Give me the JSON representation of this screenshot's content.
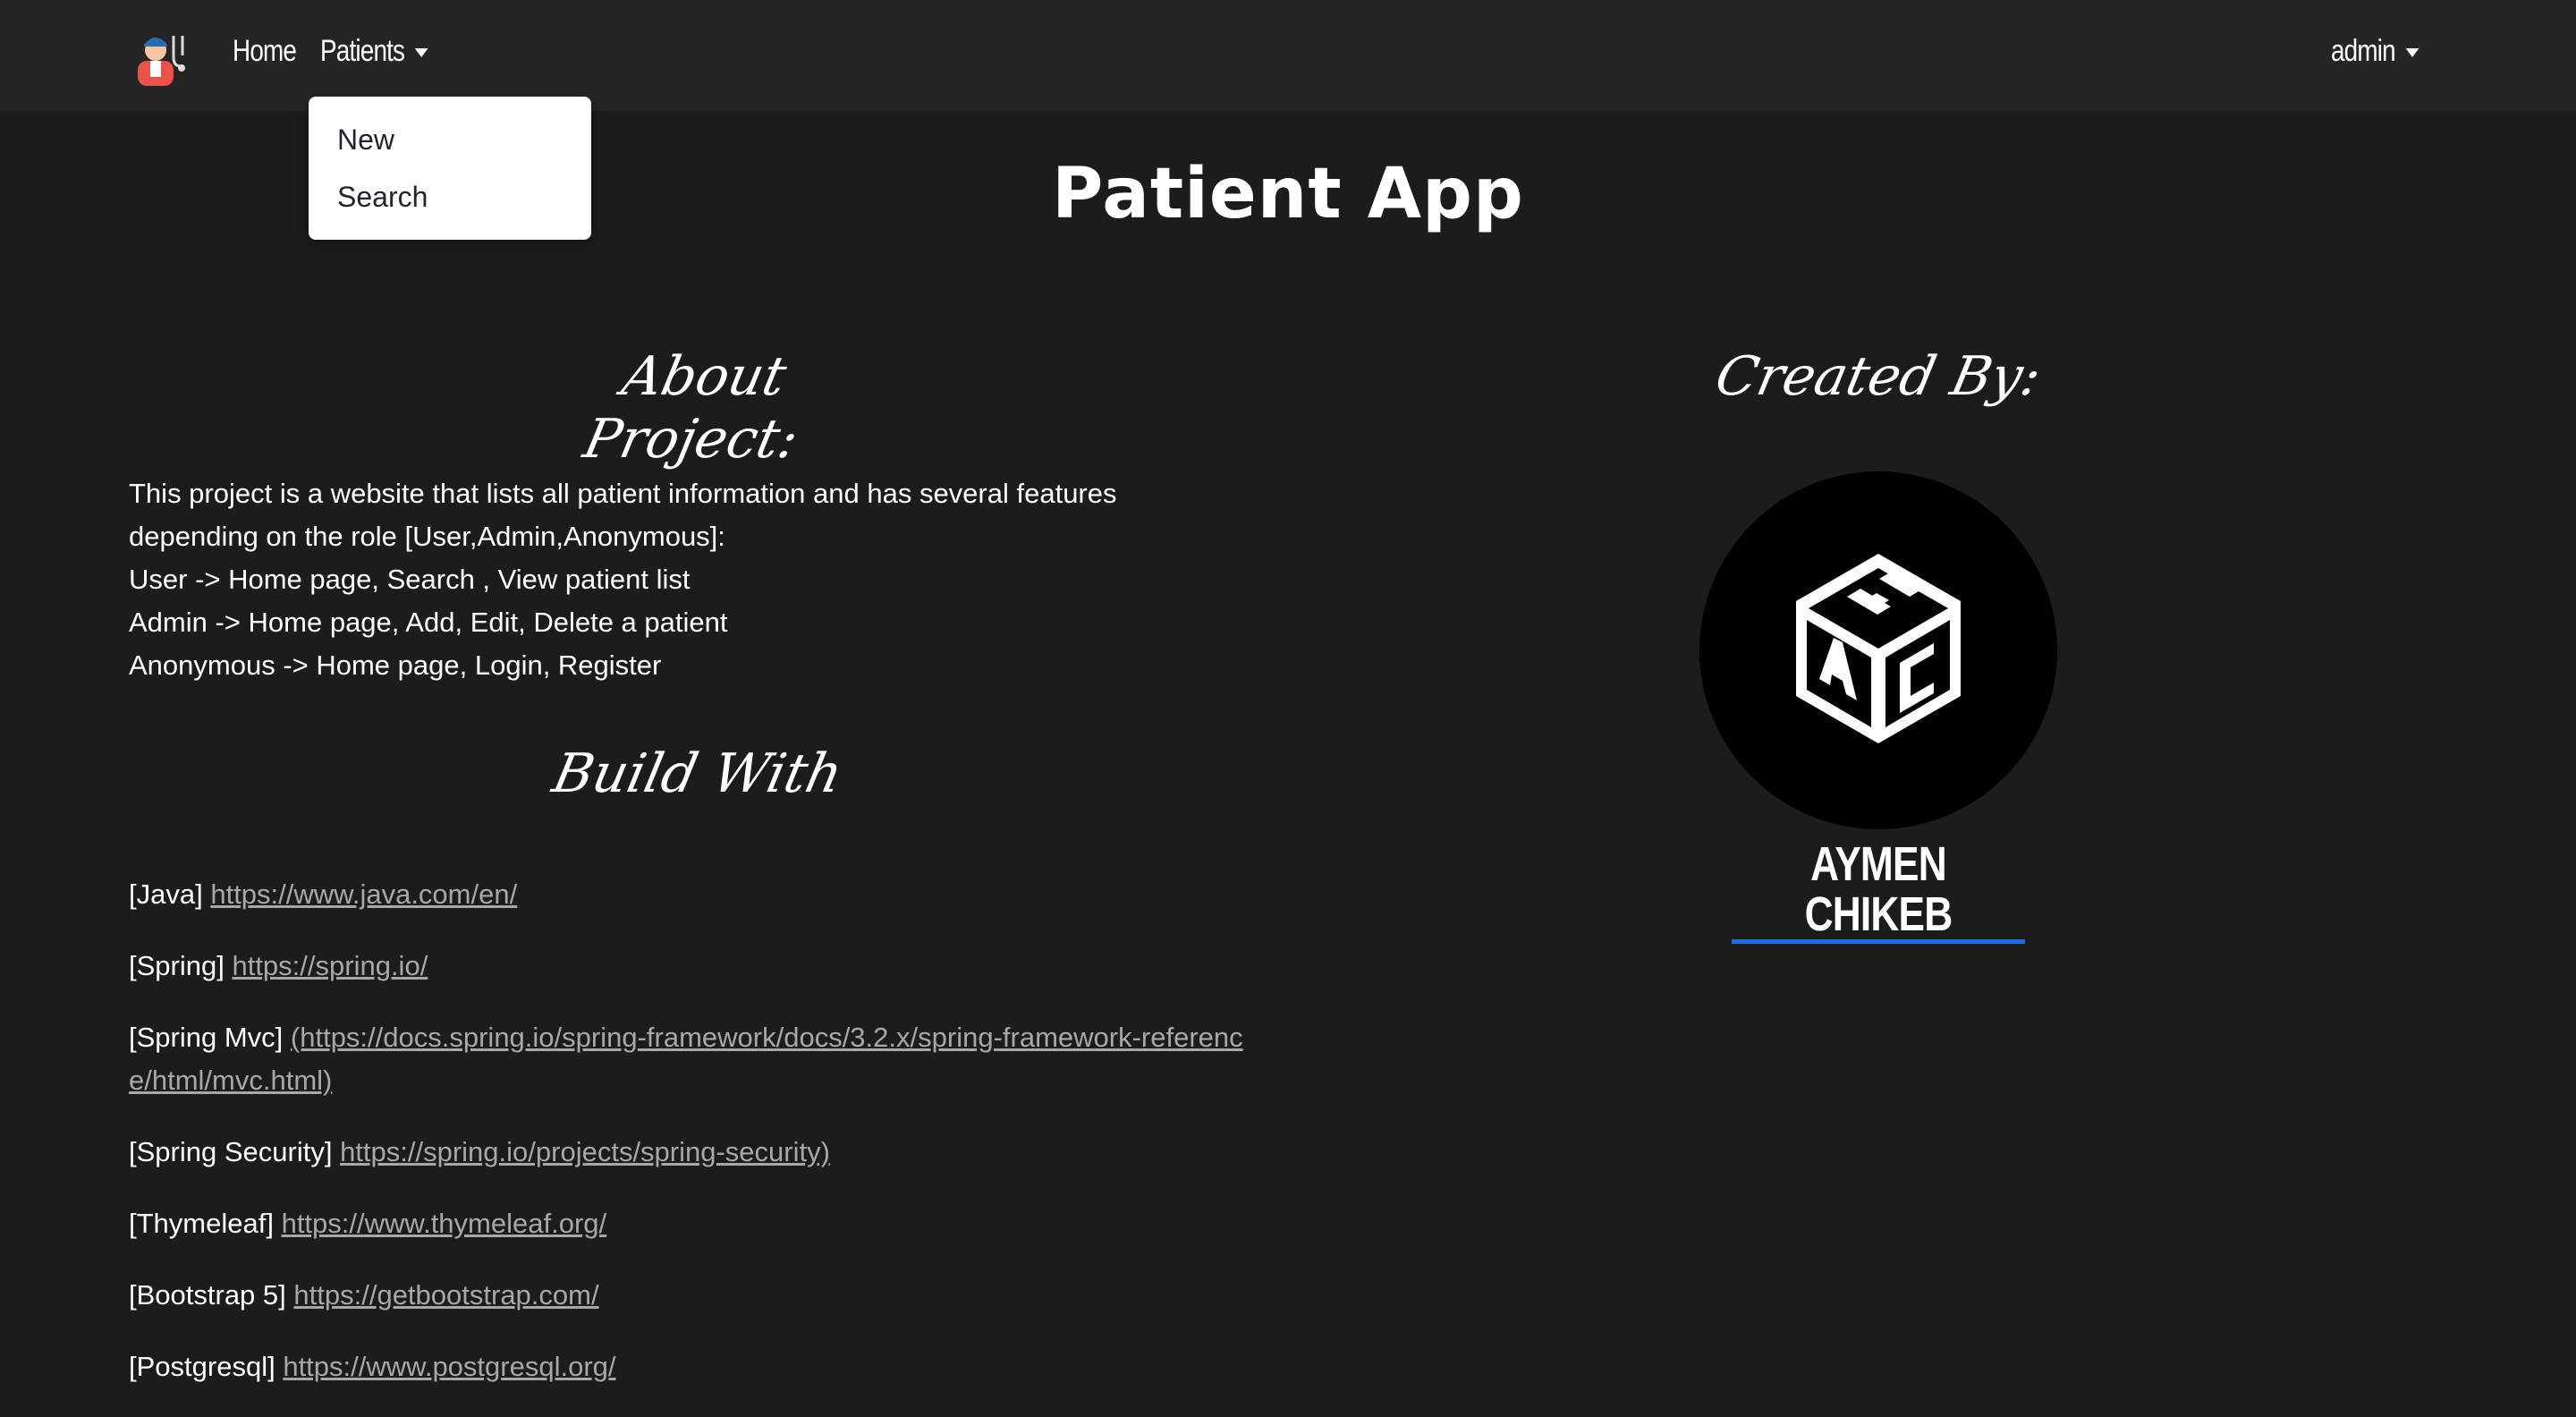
{
  "nav": {
    "home_label": "Home",
    "patients_label": "Patients",
    "user_label": "admin",
    "logo_icon": "doctor-icon"
  },
  "patients_menu": {
    "items": [
      "New",
      "Search"
    ]
  },
  "page": {
    "title": "Patient App"
  },
  "about": {
    "heading": "About Project:",
    "lines": [
      "This project is a website that lists all patient information and has several features",
      "depending on the role [User,Admin,Anonymous]:",
      "User -> Home page, Search , View patient list",
      "Admin -> Home page, Add, Edit, Delete a patient",
      "Anonymous -> Home page, Login, Register"
    ]
  },
  "build": {
    "heading": "Build With",
    "items": [
      {
        "name": "[Java]",
        "url": "https://www.java.com/en/"
      },
      {
        "name": "[Spring]",
        "url": "https://spring.io/"
      },
      {
        "name": "[Spring Mvc]",
        "url": "(https://docs.spring.io/spring-framework/docs/3.2.x/spring-framework-reference/html/mvc.html)"
      },
      {
        "name": "[Spring Security]",
        "url": "https://spring.io/projects/spring-security)"
      },
      {
        "name": "[Thymeleaf]",
        "url": "https://www.thymeleaf.org/"
      },
      {
        "name": "[Bootstrap 5]",
        "url": "https://getbootstrap.com/"
      },
      {
        "name": "[Postgresql]",
        "url": "https://www.postgresql.org/"
      }
    ]
  },
  "creator": {
    "heading": "Created By:",
    "name": "AYMEN CHIKEB",
    "logo_icon": "hac-cube-logo",
    "accent_color": "#1a6fe0"
  }
}
